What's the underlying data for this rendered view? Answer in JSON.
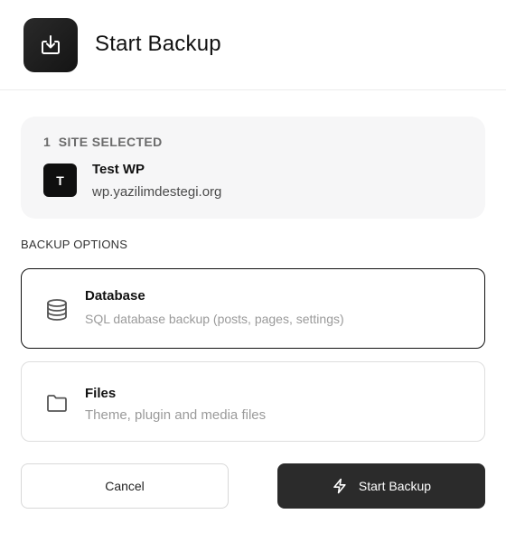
{
  "header": {
    "title": "Start Backup",
    "icon": "download-box-icon"
  },
  "site": {
    "count_label": "1  SITE SELECTED",
    "avatar_letter": "T",
    "name": "Test WP",
    "url": "wp.yazilimdestegi.org"
  },
  "options": {
    "section_label": "BACKUP OPTIONS",
    "items": [
      {
        "title": "Database",
        "description": "SQL database backup (posts, pages, settings)",
        "icon": "database-icon",
        "selected": true
      },
      {
        "title": "Files",
        "description": "Theme, plugin and media files",
        "icon": "folder-icon",
        "selected": false
      }
    ]
  },
  "actions": {
    "cancel_label": "Cancel",
    "start_label": "Start Backup",
    "start_icon": "lightning-icon"
  },
  "colors": {
    "primary": "#2b2b2b",
    "card_bg": "#f6f6f7",
    "muted_text": "#9a9a9a"
  }
}
